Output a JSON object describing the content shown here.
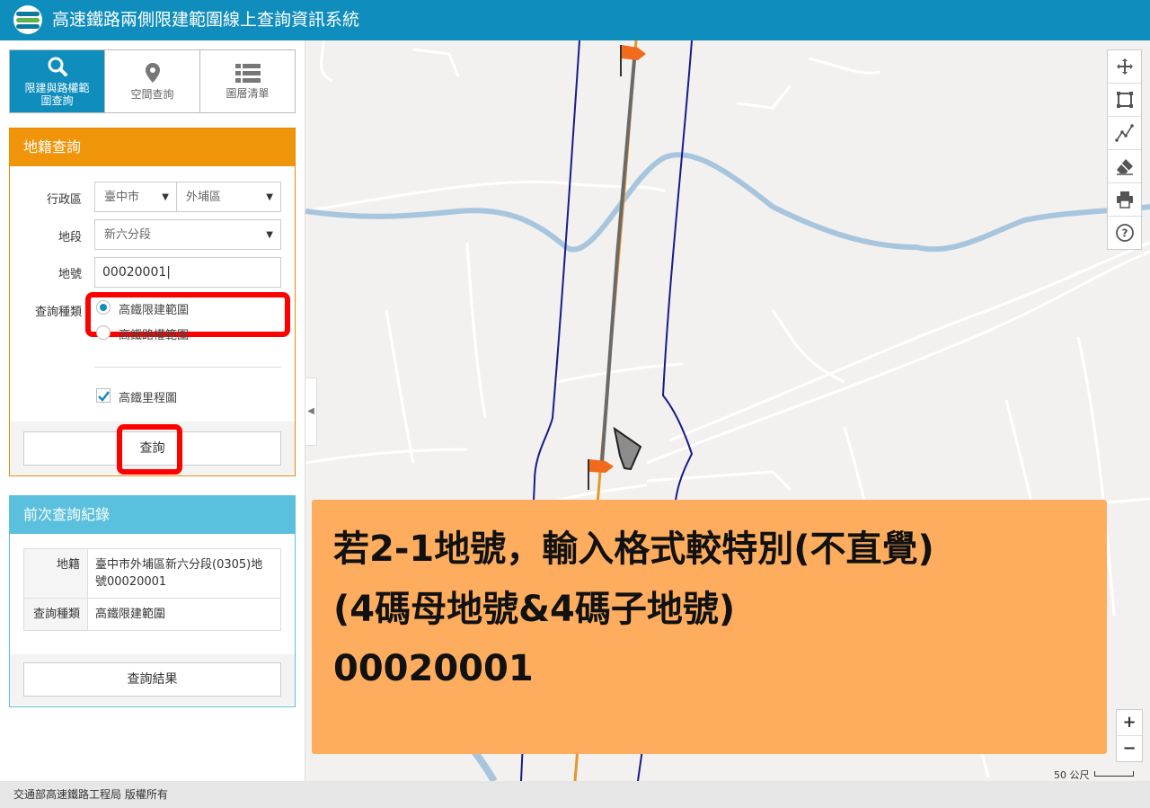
{
  "app": {
    "title": "高速鐵路兩側限建範圍線上查詢資訊系統"
  },
  "tabs": [
    {
      "label": "限建與路權範圍查詢",
      "icon": "search-icon",
      "active": true
    },
    {
      "label": "空間查詢",
      "icon": "map-marker-icon",
      "active": false
    },
    {
      "label": "圖層清單",
      "icon": "list-icon",
      "active": false
    }
  ],
  "cadastral": {
    "header": "地籍查詢",
    "district_label": "行政區",
    "city": "臺中市",
    "town": "外埔區",
    "section_label": "地段",
    "section": "新六分段",
    "lot_label": "地號",
    "lot_value": "00020001",
    "query_type_label": "查詢種類",
    "options": [
      "高鐵限建範圍",
      "高鐵路權範圍"
    ],
    "selected_option": "高鐵限建範圍",
    "mileage_label": "高鐵里程圖",
    "mileage_checked": true,
    "query_button": "查詢"
  },
  "history": {
    "header": "前次查詢紀錄",
    "rows": [
      {
        "key": "地籍",
        "value": "臺中市外埔區新六分段(0305)地號00020001"
      },
      {
        "key": "查詢種類",
        "value": "高鐵限建範圍"
      }
    ],
    "result_button": "查詢結果"
  },
  "map": {
    "tools": [
      "move-icon",
      "select-area-icon",
      "measure-line-icon",
      "eraser-icon",
      "print-icon",
      "help-icon"
    ],
    "zoom_in": "+",
    "zoom_out": "−",
    "scale_label": "50 公尺"
  },
  "annotation": {
    "lines": [
      "若2-1地號，輸入格式較特別(不直覺)",
      "(4碼母地號&4碼子地號)",
      "00020001"
    ]
  },
  "footer": {
    "text": "交通部高速鐵路工程局 版權所有"
  },
  "colors": {
    "header": "#0f8dbd",
    "orange": "#f0950a",
    "info": "#5bc0de",
    "highlight": "#ff0000",
    "callout": "#fead5e"
  }
}
